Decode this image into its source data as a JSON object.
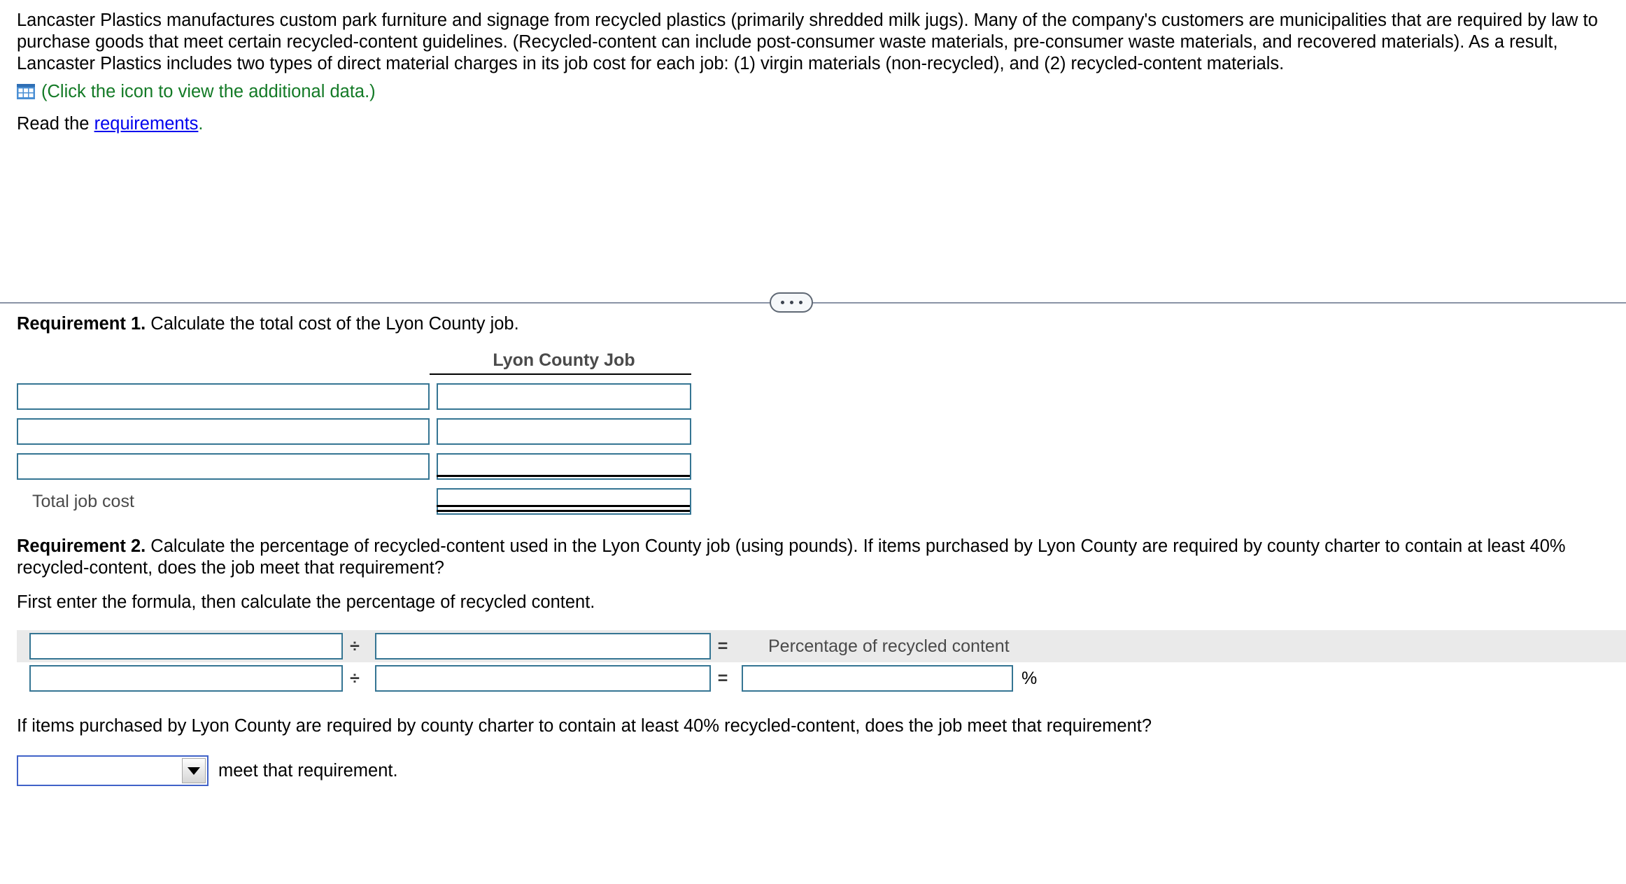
{
  "intro": {
    "paragraph": "Lancaster Plastics manufactures custom park furniture and signage from recycled plastics (primarily shredded milk jugs). Many of the company's customers are municipalities that are required by law to purchase goods that meet certain recycled-content guidelines. (Recycled-content can include post-consumer waste materials, pre-consumer waste materials, and recovered materials). As a result, Lancaster Plastics includes two types of direct material charges in its job cost for each job: (1) virgin materials (non-recycled), and (2) recycled-content materials.",
    "data_icon_name": "table-grid-icon",
    "data_link_text": "(Click the icon to view the additional data.)",
    "read_prefix": "Read the ",
    "read_link": "requirements",
    "read_suffix": ".",
    "link_color": "#0000ee",
    "green_color": "#137a26"
  },
  "divider": {
    "dots_label": "•••",
    "line_color": "#8a93a6"
  },
  "requirement1": {
    "label": "Requirement 1.",
    "text": " Calculate the total cost of the Lyon County job.",
    "column_header": "Lyon County Job",
    "rows": [
      {
        "label": "",
        "value": ""
      },
      {
        "label": "",
        "value": ""
      },
      {
        "label": "",
        "value": ""
      }
    ],
    "total_label": "Total job cost",
    "total_value": ""
  },
  "requirement2": {
    "label": "Requirement 2.",
    "text": " Calculate the percentage of recycled-content used in the Lyon County job (using pounds). If items purchased by Lyon County are required by county charter to contain at least 40% recycled-content, does the job meet that requirement?",
    "instruction": "First enter the formula, then calculate the percentage of recycled content.",
    "formula": {
      "divide_symbol": "÷",
      "equals_symbol": "=",
      "result_label": "Percentage of recycled content",
      "percent_symbol": "%",
      "row1": {
        "numerator": "",
        "denominator": ""
      },
      "row2": {
        "numerator": "",
        "denominator": "",
        "result": ""
      }
    },
    "question": "If items purchased by Lyon County are required by county charter to contain at least 40% recycled-content, does the job meet that requirement?",
    "dropdown": {
      "value": "",
      "suffix": "meet that requirement."
    }
  },
  "colors": {
    "input_border": "#357593",
    "select_border": "#4062c8",
    "shaded_row": "#eaeaea",
    "muted_text": "#4a4a4a"
  }
}
